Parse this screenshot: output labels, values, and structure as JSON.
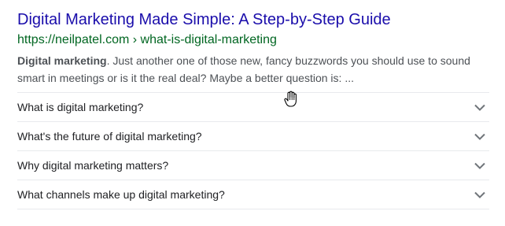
{
  "result": {
    "title": "Digital Marketing Made Simple: A Step-by-Step Guide",
    "url": "https://neilpatel.com › what-is-digital-marketing",
    "snippet_bold": "Digital marketing",
    "snippet_rest": ". Just another one of those new, fancy buzzwords you should use to sound smart in meetings or is it the real deal? Maybe a better question is: ..."
  },
  "questions": [
    "What is digital marketing?",
    "What's the future of digital marketing?",
    "Why digital marketing matters?",
    "What channels make up digital marketing?"
  ],
  "colors": {
    "title_link": "#1a0dab",
    "url_green": "#006621",
    "snippet_text": "#4d5156",
    "question_text": "#202124",
    "divider": "#e8eaed",
    "chevron": "#70757a"
  },
  "icons": {
    "expand": "chevron-down-icon",
    "cursor": "hand-cursor-icon"
  }
}
